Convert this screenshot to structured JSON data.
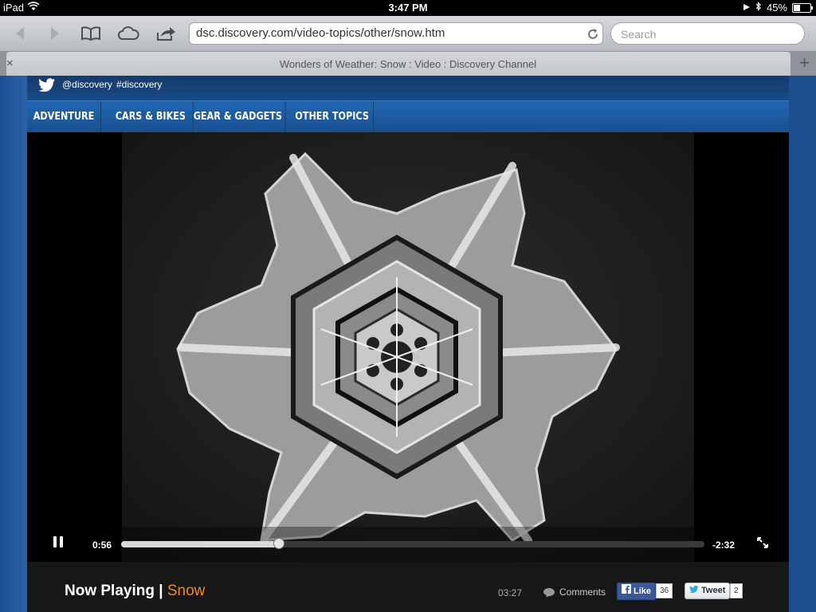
{
  "status_bar": {
    "device": "iPad",
    "time": "3:47 PM",
    "battery": "45%",
    "battery_level": 0.45,
    "icons": [
      "wifi-icon",
      "location-arrow-icon",
      "bluetooth-icon",
      "battery-icon"
    ]
  },
  "browser": {
    "url": "dsc.discovery.com/video-topics/other/snow.htm",
    "search_placeholder": "Search",
    "tab_title": "Wonders of Weather: Snow : Video : Discovery Channel",
    "tab_close": "×",
    "new_tab": "+",
    "icons": [
      "back-icon",
      "forward-icon",
      "bookmarks-icon",
      "icloud-tabs-icon",
      "share-icon",
      "reload-icon"
    ]
  },
  "social": {
    "handle": "@discovery",
    "hashtag": "#discovery"
  },
  "nav": {
    "items": [
      "ADVENTURE",
      "CARS & BIKES",
      "GEAR & GADGETS",
      "OTHER TOPICS"
    ]
  },
  "player": {
    "elapsed": "0:56",
    "remaining": "-2:32",
    "progress": 0.27,
    "state": "playing"
  },
  "info": {
    "now_playing_label": "Now Playing |",
    "video_title": "Snow",
    "duration": "03:27",
    "comments_label": "Comments",
    "like_label": "Like",
    "like_count": "36",
    "tweet_label": "Tweet",
    "tweet_count": "2"
  },
  "colors": {
    "brand_blue": "#1f5aa0",
    "accent_orange": "#f08b1d",
    "facebook_blue": "#3b5998"
  }
}
